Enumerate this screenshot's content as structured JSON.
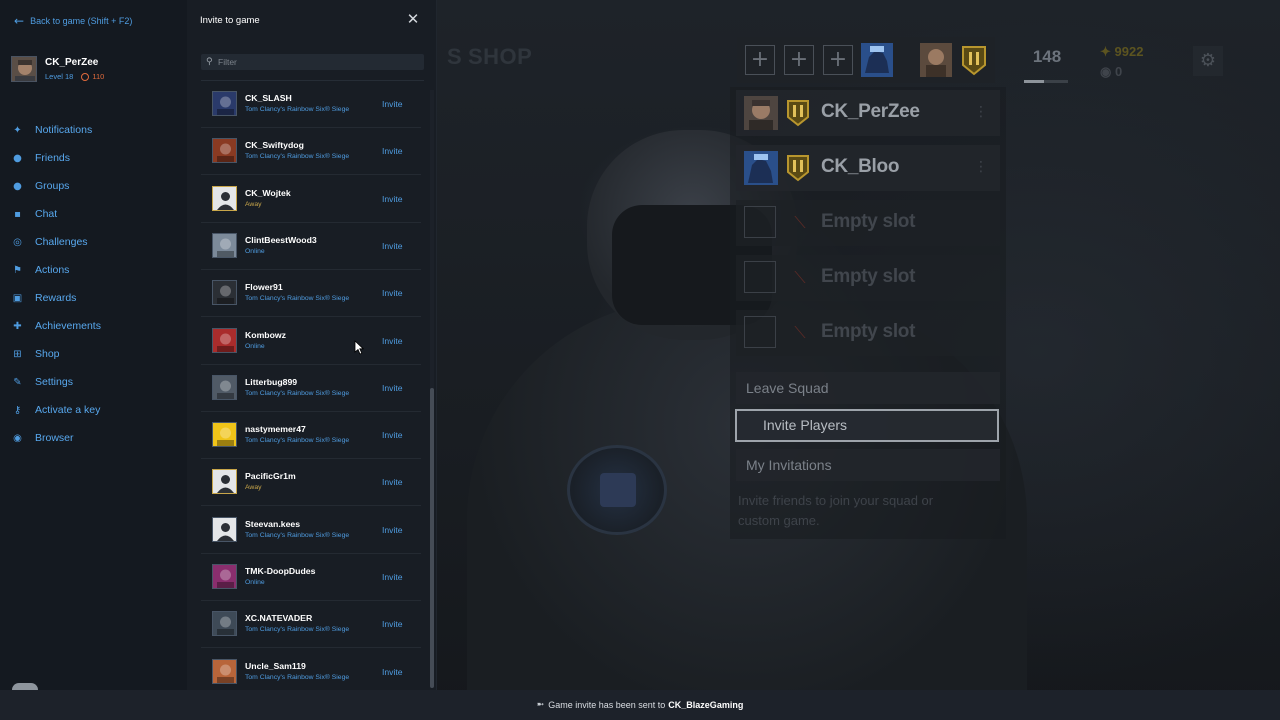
{
  "sidebar": {
    "back_label": "Back to game (Shift + F2)",
    "profile": {
      "username": "CK_PerZee",
      "level": "Level 18",
      "units": "110"
    },
    "nav": [
      {
        "label": "Notifications",
        "icon": "bell-icon"
      },
      {
        "label": "Friends",
        "icon": "friends-icon"
      },
      {
        "label": "Groups",
        "icon": "groups-icon"
      },
      {
        "label": "Chat",
        "icon": "chat-icon"
      },
      {
        "label": "Challenges",
        "icon": "challenges-icon"
      },
      {
        "label": "Actions",
        "icon": "flag-icon"
      },
      {
        "label": "Rewards",
        "icon": "gift-icon"
      },
      {
        "label": "Achievements",
        "icon": "trophy-icon"
      },
      {
        "label": "Shop",
        "icon": "cart-icon"
      },
      {
        "label": "Settings",
        "icon": "wrench-icon"
      },
      {
        "label": "Activate a key",
        "icon": "key-icon"
      },
      {
        "label": "Browser",
        "icon": "globe-icon"
      }
    ]
  },
  "invite_panel": {
    "title": "Invite to game",
    "filter_placeholder": "Filter",
    "invite_label": "Invite",
    "friends": [
      {
        "name": "CK_SLASH",
        "status": "Tom Clancy's Rainbow Six® Siege",
        "state": "ingame",
        "avatar_color": "#2a3a6a"
      },
      {
        "name": "CK_Swiftydog",
        "status": "Tom Clancy's Rainbow Six® Siege",
        "state": "ingame",
        "avatar_color": "#8a3a22"
      },
      {
        "name": "CK_Wojtek",
        "status": "Away",
        "state": "away",
        "avatar_color": "#e4e6e8"
      },
      {
        "name": "ClintBeestWood3",
        "status": "Online",
        "state": "online",
        "avatar_color": "#7c8a9a"
      },
      {
        "name": "Flower91",
        "status": "Tom Clancy's Rainbow Six® Siege",
        "state": "ingame",
        "avatar_color": "#2b2f35"
      },
      {
        "name": "Kombowz",
        "status": "Online",
        "state": "online",
        "avatar_color": "#a92c2c"
      },
      {
        "name": "Litterbug899",
        "status": "Tom Clancy's Rainbow Six® Siege",
        "state": "ingame",
        "avatar_color": "#505a66"
      },
      {
        "name": "nastymemer47",
        "status": "Tom Clancy's Rainbow Six® Siege",
        "state": "ingame",
        "avatar_color": "#f0c419"
      },
      {
        "name": "PacificGr1m",
        "status": "Away",
        "state": "away",
        "avatar_color": "#e4e6e8"
      },
      {
        "name": "Steevan.kees",
        "status": "Tom Clancy's Rainbow Six® Siege",
        "state": "ingame",
        "avatar_color": "#e4e6e8"
      },
      {
        "name": "TMK-DoopDudes",
        "status": "Online",
        "state": "online",
        "avatar_color": "#8a2e6e"
      },
      {
        "name": "XC.NATEVADER",
        "status": "Tom Clancy's Rainbow Six® Siege",
        "state": "ingame",
        "avatar_color": "#3e4a57"
      },
      {
        "name": "Uncle_Sam119",
        "status": "Tom Clancy's Rainbow Six® Siege",
        "state": "ingame",
        "avatar_color": "#b8653a"
      }
    ]
  },
  "game": {
    "top_tab": "SHOP",
    "player_level": "148",
    "renown": "9922",
    "r6_credits": "0",
    "squad": [
      {
        "name": "CK_PerZee",
        "empty": false
      },
      {
        "name": "CK_Bloo",
        "empty": false
      },
      {
        "name": "Empty slot",
        "empty": true
      },
      {
        "name": "Empty slot",
        "empty": true
      },
      {
        "name": "Empty slot",
        "empty": true
      }
    ],
    "leave_squad": "Leave Squad",
    "invite_players": "Invite Players",
    "my_invitations": "My Invitations",
    "hint": "Invite friends to join your squad or custom game."
  },
  "toast": {
    "message": "Game invite has been sent to",
    "recipient": "CK_BlazeGaming"
  },
  "colors": {
    "accent_blue": "#4f9ce0",
    "away_yellow": "#c8a64a",
    "units_orange": "#e06a3c"
  }
}
